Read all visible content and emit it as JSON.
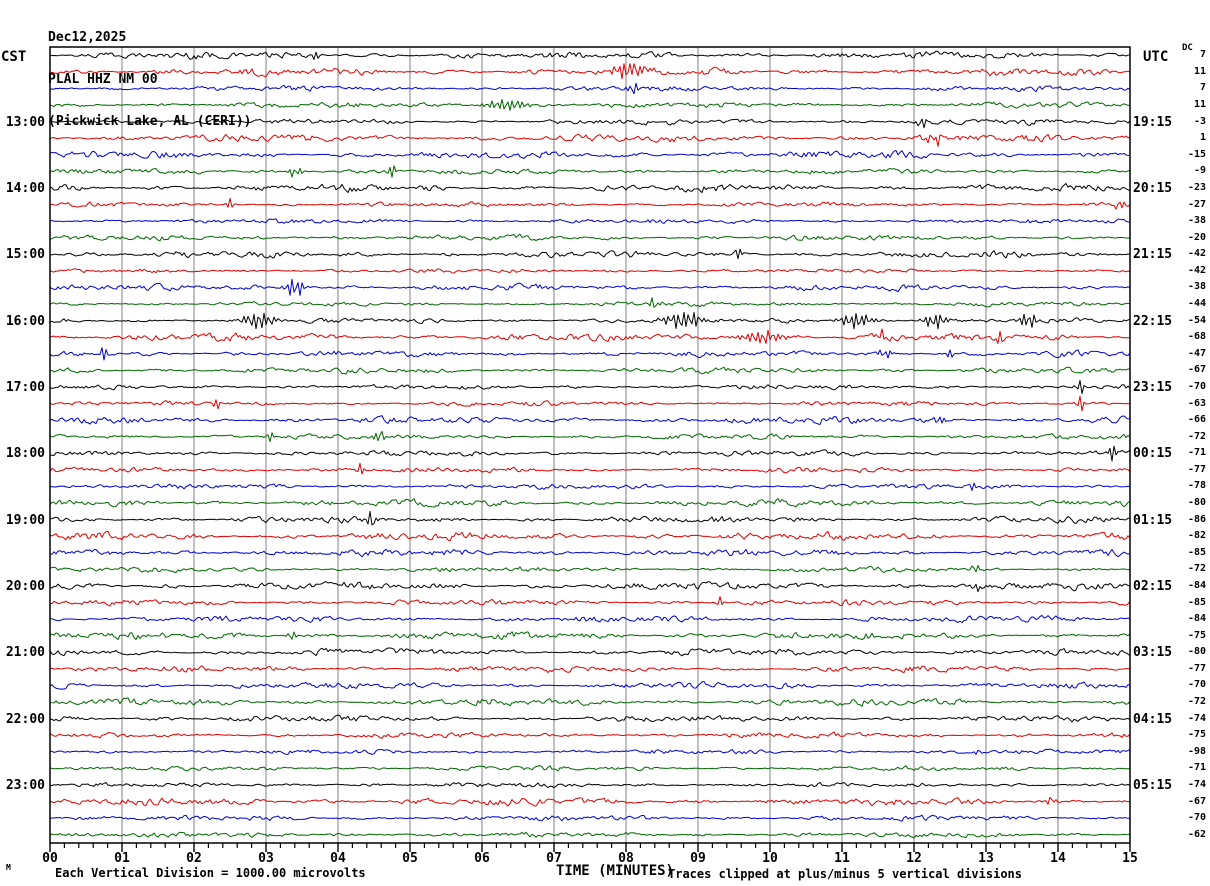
{
  "header": {
    "line1": "Dec12,2025",
    "line2": "PLAL HHZ NM 00",
    "line3": "(Pickwick Lake, AL (CERI))"
  },
  "left_axis": {
    "label": "CST",
    "hours": [
      "13:00",
      "14:00",
      "15:00",
      "16:00",
      "17:00",
      "18:00",
      "19:00",
      "20:00",
      "21:00",
      "22:00",
      "23:00"
    ]
  },
  "right_axis": {
    "label": "UTC",
    "dc_label": "DC",
    "hours": [
      "19:15",
      "20:15",
      "21:15",
      "22:15",
      "23:15",
      "00:15",
      "01:15",
      "02:15",
      "03:15",
      "04:15",
      "05:15"
    ]
  },
  "x_axis": {
    "label": "TIME (MINUTES)",
    "ticks": [
      "00",
      "01",
      "02",
      "03",
      "04",
      "05",
      "06",
      "07",
      "08",
      "09",
      "10",
      "11",
      "12",
      "13",
      "14",
      "15"
    ]
  },
  "footer": {
    "left": "Each Vertical Division = 1000.00 microvolts",
    "right": "Traces clipped at plus/minus 5 vertical divisions",
    "watermark": "M"
  },
  "colors": {
    "black": "#000000",
    "red": "#dd0000",
    "blue": "#0000cc",
    "green": "#006600",
    "grid": "#808080",
    "border": "#000000",
    "background": "#ffffff"
  },
  "chart_data": {
    "type": "line",
    "subtype": "helicorder",
    "date": "Dec12,2025",
    "station": "PLAL HHZ NM 00",
    "station_name": "Pickwick Lake, AL (CERI)",
    "rows": 48,
    "minutes_per_row": 15,
    "x_range_minutes": [
      0,
      15
    ],
    "grid": "vertical lines each minute",
    "trace_color_cycle": [
      "black",
      "red",
      "blue",
      "green"
    ],
    "hour_label_rows": [
      4,
      8,
      12,
      16,
      20,
      24,
      28,
      32,
      36,
      40,
      44
    ],
    "dc_offsets": [
      7,
      11,
      7,
      11,
      -3,
      1,
      -15,
      -9,
      -23,
      -27,
      -38,
      -20,
      -42,
      -42,
      -38,
      -44,
      -54,
      -68,
      -47,
      -67,
      -70,
      -63,
      -66,
      -72,
      -71,
      -77,
      -78,
      -80,
      -86,
      -82,
      -85,
      -72,
      -84,
      -85,
      -84,
      -75,
      -80,
      -77,
      -70,
      -72,
      -74,
      -75,
      -98,
      -71,
      -74,
      -67,
      -70,
      -62
    ],
    "clip_note": "Traces clipped at plus/minus 5 vertical divisions",
    "scale_note": "Each Vertical Division = 1000.00 microvolts",
    "events": [
      {
        "row": 0,
        "minute": 3.7,
        "amp": 7,
        "width": 0.05
      },
      {
        "row": 1,
        "minute": 8.05,
        "amp": 11,
        "width": 0.25
      },
      {
        "row": 2,
        "minute": 8.1,
        "amp": -10,
        "width": 0.06
      },
      {
        "row": 3,
        "minute": 6.35,
        "amp": 7,
        "width": 0.3
      },
      {
        "row": 4,
        "minute": 12.1,
        "amp": 11,
        "width": 0.05
      },
      {
        "row": 5,
        "minute": 12.3,
        "amp": 6,
        "width": 0.15
      },
      {
        "row": 7,
        "minute": 3.4,
        "amp": 7,
        "width": 0.1
      },
      {
        "row": 7,
        "minute": 4.75,
        "amp": -9,
        "width": 0.05
      },
      {
        "row": 9,
        "minute": 2.5,
        "amp": 7,
        "width": 0.06
      },
      {
        "row": 9,
        "minute": 14.85,
        "amp": 8,
        "width": 0.06
      },
      {
        "row": 12,
        "minute": 9.55,
        "amp": -8,
        "width": 0.06
      },
      {
        "row": 14,
        "minute": 3.4,
        "amp": -12,
        "width": 0.12
      },
      {
        "row": 15,
        "minute": 8.4,
        "amp": -9,
        "width": 0.06
      },
      {
        "row": 16,
        "minute": 2.9,
        "amp": 11,
        "width": 0.2
      },
      {
        "row": 16,
        "minute": 8.8,
        "amp": 12,
        "width": 0.25
      },
      {
        "row": 16,
        "minute": 11.2,
        "amp": 11,
        "width": 0.2
      },
      {
        "row": 16,
        "minute": 12.3,
        "amp": 10,
        "width": 0.15
      },
      {
        "row": 16,
        "minute": 13.6,
        "amp": 9,
        "width": 0.12
      },
      {
        "row": 17,
        "minute": 9.9,
        "amp": 8,
        "width": 0.3
      },
      {
        "row": 17,
        "minute": 11.55,
        "amp": 10,
        "width": 0.05
      },
      {
        "row": 17,
        "minute": 13.2,
        "amp": 8,
        "width": 0.05
      },
      {
        "row": 18,
        "minute": 0.75,
        "amp": -9,
        "width": 0.06
      },
      {
        "row": 18,
        "minute": 11.6,
        "amp": 7,
        "width": 0.08
      },
      {
        "row": 18,
        "minute": 12.5,
        "amp": 6,
        "width": 0.06
      },
      {
        "row": 20,
        "minute": 14.3,
        "amp": 10,
        "width": 0.06
      },
      {
        "row": 21,
        "minute": 2.3,
        "amp": 7,
        "width": 0.06
      },
      {
        "row": 21,
        "minute": 14.3,
        "amp": 12,
        "width": 0.05
      },
      {
        "row": 22,
        "minute": 12.35,
        "amp": 8,
        "width": 0.06
      },
      {
        "row": 23,
        "minute": 3.05,
        "amp": -8,
        "width": 0.05
      },
      {
        "row": 23,
        "minute": 4.6,
        "amp": 7,
        "width": 0.08
      },
      {
        "row": 24,
        "minute": 14.75,
        "amp": -11,
        "width": 0.06
      },
      {
        "row": 25,
        "minute": 4.3,
        "amp": 8,
        "width": 0.05
      },
      {
        "row": 26,
        "minute": 12.8,
        "amp": -7,
        "width": 0.05
      },
      {
        "row": 28,
        "minute": 4.45,
        "amp": 14,
        "width": 0.05
      },
      {
        "row": 31,
        "minute": 12.85,
        "amp": -8,
        "width": 0.05
      },
      {
        "row": 32,
        "minute": 12.85,
        "amp": 8,
        "width": 0.05
      },
      {
        "row": 33,
        "minute": 9.3,
        "amp": 7,
        "width": 0.05
      },
      {
        "row": 35,
        "minute": 3.35,
        "amp": -8,
        "width": 0.05
      },
      {
        "row": 42,
        "minute": 12.9,
        "amp": 6,
        "width": 0.05
      },
      {
        "row": 45,
        "minute": 13.9,
        "amp": 11,
        "width": 0.05
      }
    ]
  }
}
